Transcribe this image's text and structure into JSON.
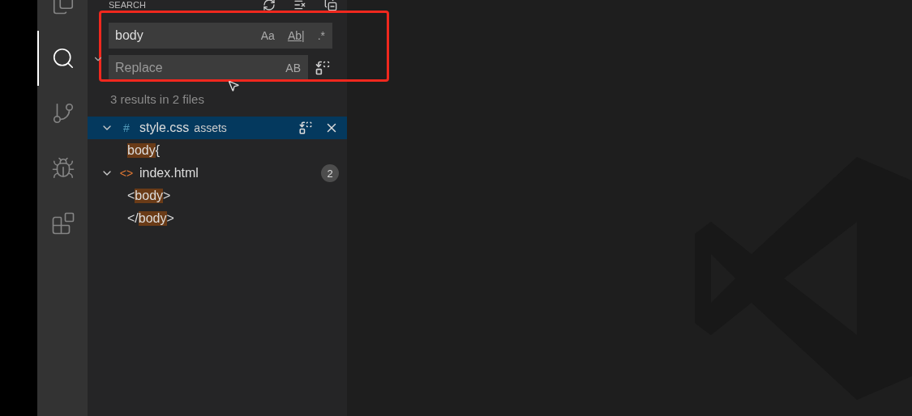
{
  "sidebar": {
    "title": "SEARCH",
    "search": {
      "value": "body",
      "options": [
        {
          "label": "Aa",
          "kind": "case",
          "on": false
        },
        {
          "label": "Ab|",
          "kind": "word",
          "on": false
        },
        {
          "label": ".*",
          "kind": "regex",
          "on": false
        }
      ]
    },
    "replace": {
      "placeholder": "Replace",
      "option": "AB"
    },
    "summary": "3 results in 2 files",
    "files": [
      {
        "icon": "#",
        "kind": "css",
        "name": "style.css",
        "folder": "assets",
        "selected": true,
        "expanded": true,
        "matches": [
          {
            "match": "body",
            "after": " {"
          }
        ]
      },
      {
        "icon": "<>",
        "kind": "html",
        "name": "index.html",
        "count": "2",
        "selected": false,
        "expanded": true,
        "matches": [
          {
            "before": "<",
            "match": "body",
            "after": ">"
          },
          {
            "before": "</",
            "match": "body",
            "after": ">"
          }
        ]
      }
    ]
  },
  "activity": [
    {
      "kind": "files",
      "selected": false
    },
    {
      "kind": "search",
      "selected": true
    },
    {
      "kind": "git",
      "selected": false
    },
    {
      "kind": "debug",
      "selected": false
    },
    {
      "kind": "extensions",
      "selected": false
    }
  ]
}
